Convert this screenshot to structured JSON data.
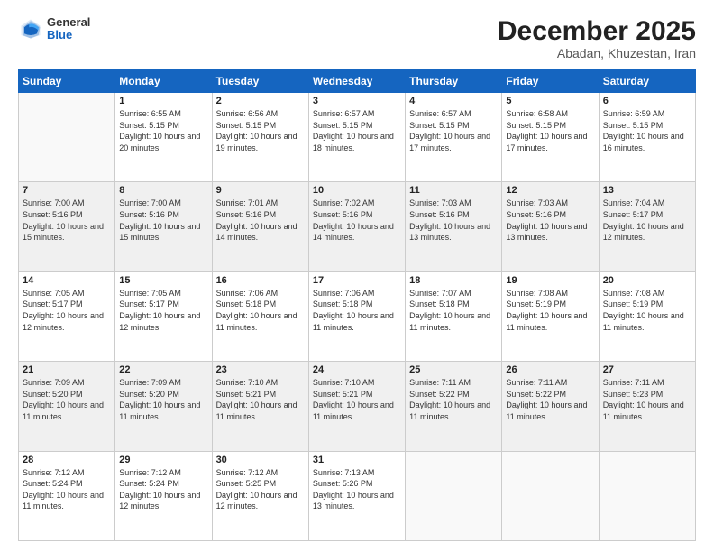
{
  "header": {
    "logo_general": "General",
    "logo_blue": "Blue",
    "month_title": "December 2025",
    "location": "Abadan, Khuzestan, Iran"
  },
  "weekdays": [
    "Sunday",
    "Monday",
    "Tuesday",
    "Wednesday",
    "Thursday",
    "Friday",
    "Saturday"
  ],
  "weeks": [
    [
      {
        "day": "",
        "sunrise": "",
        "sunset": "",
        "daylight": ""
      },
      {
        "day": "1",
        "sunrise": "Sunrise: 6:55 AM",
        "sunset": "Sunset: 5:15 PM",
        "daylight": "Daylight: 10 hours and 20 minutes."
      },
      {
        "day": "2",
        "sunrise": "Sunrise: 6:56 AM",
        "sunset": "Sunset: 5:15 PM",
        "daylight": "Daylight: 10 hours and 19 minutes."
      },
      {
        "day": "3",
        "sunrise": "Sunrise: 6:57 AM",
        "sunset": "Sunset: 5:15 PM",
        "daylight": "Daylight: 10 hours and 18 minutes."
      },
      {
        "day": "4",
        "sunrise": "Sunrise: 6:57 AM",
        "sunset": "Sunset: 5:15 PM",
        "daylight": "Daylight: 10 hours and 17 minutes."
      },
      {
        "day": "5",
        "sunrise": "Sunrise: 6:58 AM",
        "sunset": "Sunset: 5:15 PM",
        "daylight": "Daylight: 10 hours and 17 minutes."
      },
      {
        "day": "6",
        "sunrise": "Sunrise: 6:59 AM",
        "sunset": "Sunset: 5:15 PM",
        "daylight": "Daylight: 10 hours and 16 minutes."
      }
    ],
    [
      {
        "day": "7",
        "sunrise": "Sunrise: 7:00 AM",
        "sunset": "Sunset: 5:16 PM",
        "daylight": "Daylight: 10 hours and 15 minutes."
      },
      {
        "day": "8",
        "sunrise": "Sunrise: 7:00 AM",
        "sunset": "Sunset: 5:16 PM",
        "daylight": "Daylight: 10 hours and 15 minutes."
      },
      {
        "day": "9",
        "sunrise": "Sunrise: 7:01 AM",
        "sunset": "Sunset: 5:16 PM",
        "daylight": "Daylight: 10 hours and 14 minutes."
      },
      {
        "day": "10",
        "sunrise": "Sunrise: 7:02 AM",
        "sunset": "Sunset: 5:16 PM",
        "daylight": "Daylight: 10 hours and 14 minutes."
      },
      {
        "day": "11",
        "sunrise": "Sunrise: 7:03 AM",
        "sunset": "Sunset: 5:16 PM",
        "daylight": "Daylight: 10 hours and 13 minutes."
      },
      {
        "day": "12",
        "sunrise": "Sunrise: 7:03 AM",
        "sunset": "Sunset: 5:16 PM",
        "daylight": "Daylight: 10 hours and 13 minutes."
      },
      {
        "day": "13",
        "sunrise": "Sunrise: 7:04 AM",
        "sunset": "Sunset: 5:17 PM",
        "daylight": "Daylight: 10 hours and 12 minutes."
      }
    ],
    [
      {
        "day": "14",
        "sunrise": "Sunrise: 7:05 AM",
        "sunset": "Sunset: 5:17 PM",
        "daylight": "Daylight: 10 hours and 12 minutes."
      },
      {
        "day": "15",
        "sunrise": "Sunrise: 7:05 AM",
        "sunset": "Sunset: 5:17 PM",
        "daylight": "Daylight: 10 hours and 12 minutes."
      },
      {
        "day": "16",
        "sunrise": "Sunrise: 7:06 AM",
        "sunset": "Sunset: 5:18 PM",
        "daylight": "Daylight: 10 hours and 11 minutes."
      },
      {
        "day": "17",
        "sunrise": "Sunrise: 7:06 AM",
        "sunset": "Sunset: 5:18 PM",
        "daylight": "Daylight: 10 hours and 11 minutes."
      },
      {
        "day": "18",
        "sunrise": "Sunrise: 7:07 AM",
        "sunset": "Sunset: 5:18 PM",
        "daylight": "Daylight: 10 hours and 11 minutes."
      },
      {
        "day": "19",
        "sunrise": "Sunrise: 7:08 AM",
        "sunset": "Sunset: 5:19 PM",
        "daylight": "Daylight: 10 hours and 11 minutes."
      },
      {
        "day": "20",
        "sunrise": "Sunrise: 7:08 AM",
        "sunset": "Sunset: 5:19 PM",
        "daylight": "Daylight: 10 hours and 11 minutes."
      }
    ],
    [
      {
        "day": "21",
        "sunrise": "Sunrise: 7:09 AM",
        "sunset": "Sunset: 5:20 PM",
        "daylight": "Daylight: 10 hours and 11 minutes."
      },
      {
        "day": "22",
        "sunrise": "Sunrise: 7:09 AM",
        "sunset": "Sunset: 5:20 PM",
        "daylight": "Daylight: 10 hours and 11 minutes."
      },
      {
        "day": "23",
        "sunrise": "Sunrise: 7:10 AM",
        "sunset": "Sunset: 5:21 PM",
        "daylight": "Daylight: 10 hours and 11 minutes."
      },
      {
        "day": "24",
        "sunrise": "Sunrise: 7:10 AM",
        "sunset": "Sunset: 5:21 PM",
        "daylight": "Daylight: 10 hours and 11 minutes."
      },
      {
        "day": "25",
        "sunrise": "Sunrise: 7:11 AM",
        "sunset": "Sunset: 5:22 PM",
        "daylight": "Daylight: 10 hours and 11 minutes."
      },
      {
        "day": "26",
        "sunrise": "Sunrise: 7:11 AM",
        "sunset": "Sunset: 5:22 PM",
        "daylight": "Daylight: 10 hours and 11 minutes."
      },
      {
        "day": "27",
        "sunrise": "Sunrise: 7:11 AM",
        "sunset": "Sunset: 5:23 PM",
        "daylight": "Daylight: 10 hours and 11 minutes."
      }
    ],
    [
      {
        "day": "28",
        "sunrise": "Sunrise: 7:12 AM",
        "sunset": "Sunset: 5:24 PM",
        "daylight": "Daylight: 10 hours and 11 minutes."
      },
      {
        "day": "29",
        "sunrise": "Sunrise: 7:12 AM",
        "sunset": "Sunset: 5:24 PM",
        "daylight": "Daylight: 10 hours and 12 minutes."
      },
      {
        "day": "30",
        "sunrise": "Sunrise: 7:12 AM",
        "sunset": "Sunset: 5:25 PM",
        "daylight": "Daylight: 10 hours and 12 minutes."
      },
      {
        "day": "31",
        "sunrise": "Sunrise: 7:13 AM",
        "sunset": "Sunset: 5:26 PM",
        "daylight": "Daylight: 10 hours and 13 minutes."
      },
      {
        "day": "",
        "sunrise": "",
        "sunset": "",
        "daylight": ""
      },
      {
        "day": "",
        "sunrise": "",
        "sunset": "",
        "daylight": ""
      },
      {
        "day": "",
        "sunrise": "",
        "sunset": "",
        "daylight": ""
      }
    ]
  ]
}
